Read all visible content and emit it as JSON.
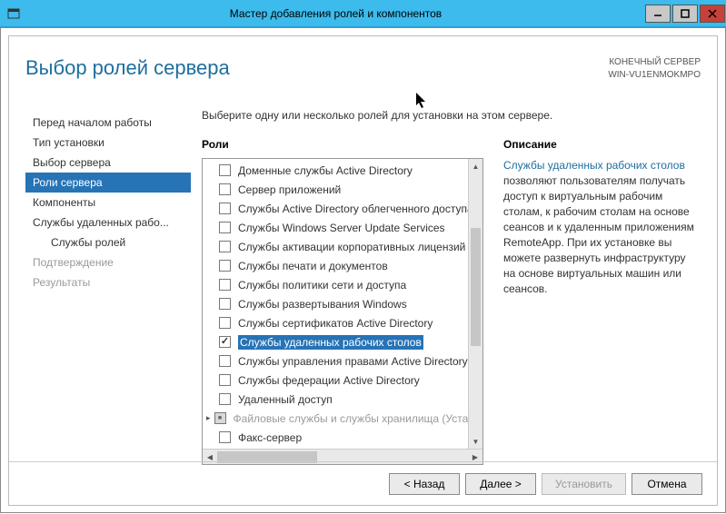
{
  "titlebar": {
    "title": "Мастер добавления ролей и компонентов"
  },
  "page_title": "Выбор ролей сервера",
  "server_info": {
    "label": "КОНЕЧНЫЙ СЕРВЕР",
    "name": "WIN-VU1ENMOKMPO"
  },
  "sidebar": [
    {
      "label": "Перед началом работы",
      "state": "normal"
    },
    {
      "label": "Тип установки",
      "state": "normal"
    },
    {
      "label": "Выбор сервера",
      "state": "normal"
    },
    {
      "label": "Роли сервера",
      "state": "active"
    },
    {
      "label": "Компоненты",
      "state": "normal"
    },
    {
      "label": "Службы удаленных рабо...",
      "state": "normal"
    },
    {
      "label": "Службы ролей",
      "state": "normal",
      "sub": true
    },
    {
      "label": "Подтверждение",
      "state": "disabled"
    },
    {
      "label": "Результаты",
      "state": "disabled"
    }
  ],
  "instruction": "Выберите одну или несколько ролей для установки на этом сервере.",
  "roles_title": "Роли",
  "roles": [
    {
      "label": "Доменные службы Active Directory",
      "checked": false
    },
    {
      "label": "Сервер приложений",
      "checked": false
    },
    {
      "label": "Службы Active Directory облегченного доступа к",
      "checked": false
    },
    {
      "label": "Службы Windows Server Update Services",
      "checked": false
    },
    {
      "label": "Службы активации корпоративных лицензий",
      "checked": false
    },
    {
      "label": "Службы печати и документов",
      "checked": false
    },
    {
      "label": "Службы политики сети и доступа",
      "checked": false
    },
    {
      "label": "Службы развертывания Windows",
      "checked": false
    },
    {
      "label": "Службы сертификатов Active Directory",
      "checked": false
    },
    {
      "label": "Службы удаленных рабочих столов",
      "checked": true,
      "selected": true
    },
    {
      "label": "Службы управления правами Active Directory",
      "checked": false
    },
    {
      "label": "Службы федерации Active Directory",
      "checked": false
    },
    {
      "label": "Удаленный доступ",
      "checked": false
    },
    {
      "label": "Файловые службы и службы хранилища (Устано",
      "checked": "partial",
      "disabled": true,
      "toggle": true
    },
    {
      "label": "Факс-сервер",
      "checked": false
    }
  ],
  "desc_title": "Описание",
  "desc": {
    "highlight": "Службы удаленных рабочих столов",
    "rest": " позволяют пользователям получать доступ к виртуальным рабочим столам, к рабочим столам на основе сеансов и к удаленным приложениям RemoteApp. При их установке вы можете развернуть инфраструктуру на основе виртуальных машин или сеансов."
  },
  "footer": {
    "back": "< Назад",
    "next": "Далее >",
    "install": "Установить",
    "cancel": "Отмена"
  }
}
